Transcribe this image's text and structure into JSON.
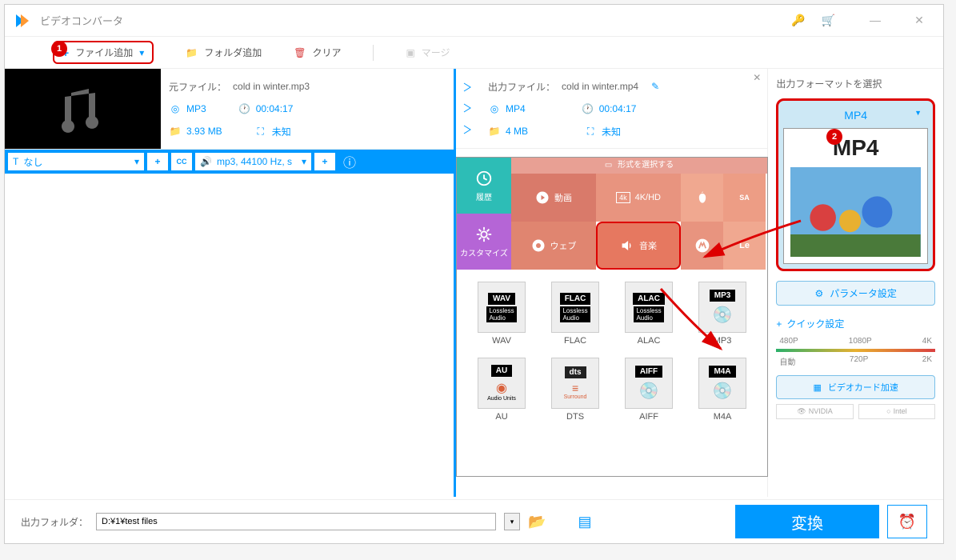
{
  "app_title": "ビデオコンバータ",
  "toolbar": {
    "add_file": "ファイル追加",
    "add_folder": "フォルダ追加",
    "clear": "クリア",
    "merge": "マージ"
  },
  "source": {
    "label": "元ファイル：",
    "filename": "cold in winter.mp3",
    "format": "MP3",
    "duration": "00:04:17",
    "filesize": "3.93 MB",
    "resolution": "未知"
  },
  "output": {
    "label": "出力ファイル：",
    "filename": "cold in winter.mp4",
    "format": "MP4",
    "duration": "00:04:17",
    "filesize": "4 MB",
    "resolution": "未知"
  },
  "audio_bar": {
    "subtitle_select": "なし",
    "audio_info": "mp3, 44100 Hz, s"
  },
  "format_popup": {
    "header": "形式を選択する",
    "side_history": "履歴",
    "side_custom": "カスタマイズ",
    "tiles": {
      "video": "動画",
      "fourk": "4K/HD",
      "web": "ウェブ",
      "music": "音楽",
      "lenovo": "Le"
    },
    "formats": [
      "WAV",
      "FLAC",
      "ALAC",
      "MP3",
      "AU",
      "DTS",
      "AIFF",
      "M4A"
    ],
    "sublabels": {
      "wav": "Lossless Audio",
      "flac": "Lossless Audio",
      "alac": "Lossless Audio",
      "au": "Audio Units",
      "dts": "Surround"
    }
  },
  "side_panel": {
    "title": "出力フォーマットを選択",
    "selected": "MP4",
    "preview_label": "MP4",
    "param_btn": "パラメータ設定",
    "quick_title": "クイック設定",
    "res": {
      "r480": "480P",
      "r1080": "1080P",
      "r4k": "4K",
      "auto": "自動",
      "r720": "720P",
      "r2k": "2K"
    },
    "gpu_btn": "ビデオカード加速",
    "gpu_nvidia": "NVIDIA",
    "gpu_intel": "Intel"
  },
  "bottom": {
    "out_label": "出力フォルダ：",
    "out_path": "D:¥1¥test files",
    "convert": "変換"
  },
  "callouts": {
    "c1": "1",
    "c2": "2"
  }
}
